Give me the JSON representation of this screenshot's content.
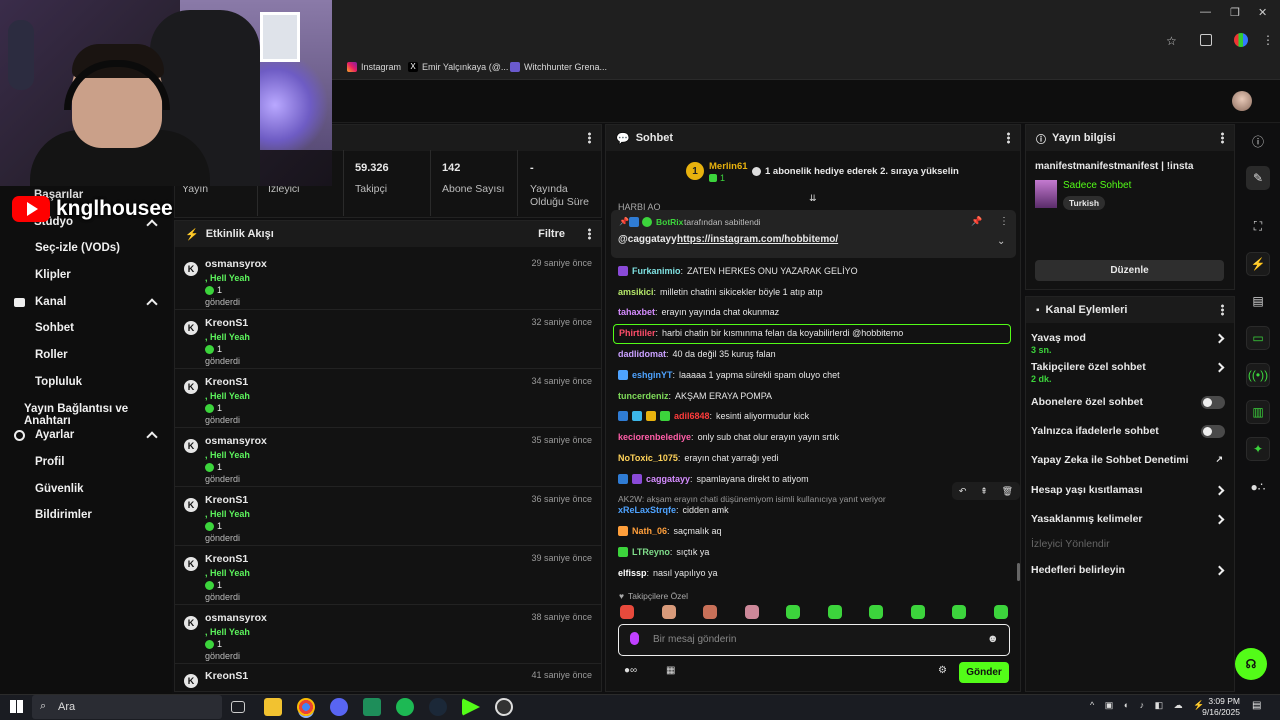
{
  "browser": {
    "bookmarks": [
      {
        "label": "Instagram",
        "icon": "instagram-icon"
      },
      {
        "label": "Emir Yalçınkaya (@...",
        "icon": "x-icon"
      },
      {
        "label": "Witchhunter Grena...",
        "icon": "shield-icon"
      }
    ]
  },
  "overlay": {
    "channel_name": "knglhousee"
  },
  "sidebar": {
    "partial_items": [
      "Başarılar",
      "Stüdyo"
    ],
    "items": [
      {
        "label": "Seç-izle (VODs)"
      },
      {
        "label": "Klipler"
      }
    ],
    "kanal": {
      "label": "Kanal",
      "items": [
        "Sohbet",
        "Roller",
        "Topluluk"
      ]
    },
    "baglanti": "Yayın Bağlantısı ve Anahtarı",
    "ayarlar": {
      "label": "Ayarlar",
      "items": [
        "Profil",
        "Güvenlik",
        "Bildirimler"
      ]
    }
  },
  "stats": {
    "yayin": {
      "label": "Yayın"
    },
    "izleyici": {
      "label": "İzleyici"
    },
    "takipci": {
      "value": "59.326",
      "label": "Takipçi"
    },
    "abone": {
      "value": "142",
      "label": "Abone Sayısı"
    },
    "sure": {
      "value": "-",
      "label": "Yayında Olduğu Süre"
    }
  },
  "activity": {
    "title": "Etkinlik Akışı",
    "filter": "Filtre",
    "items": [
      {
        "name": "osmansyrox",
        "sub": ", Hell Yeah",
        "count": "1",
        "gave": "gönderdi",
        "time": "29 saniye önce"
      },
      {
        "name": "KreonS1",
        "sub": ", Hell Yeah",
        "count": "1",
        "gave": "gönderdi",
        "time": "32 saniye önce"
      },
      {
        "name": "KreonS1",
        "sub": ", Hell Yeah",
        "count": "1",
        "gave": "gönderdi",
        "time": "34 saniye önce"
      },
      {
        "name": "osmansyrox",
        "sub": ", Hell Yeah",
        "count": "1",
        "gave": "gönderdi",
        "time": "35 saniye önce"
      },
      {
        "name": "KreonS1",
        "sub": ", Hell Yeah",
        "count": "1",
        "gave": "gönderdi",
        "time": "36 saniye önce"
      },
      {
        "name": "KreonS1",
        "sub": ", Hell Yeah",
        "count": "1",
        "gave": "gönderdi",
        "time": "39 saniye önce"
      },
      {
        "name": "osmansyrox",
        "sub": ", Hell Yeah",
        "count": "1",
        "gave": "gönderdi",
        "time": "38 saniye önce"
      },
      {
        "name": "KreonS1",
        "sub": "",
        "count": "",
        "gave": "",
        "time": "41 saniye önce"
      }
    ]
  },
  "chat": {
    "title": "Sohbet",
    "leader": {
      "rank": "1",
      "name": "Merlin61",
      "count": "1",
      "text": "1 abonelik hediye ederek 2. sıraya yükselin"
    },
    "partial_top": "HARBI AO",
    "pinned": {
      "by": "BotRix",
      "by_suffix": "tarafından sabitlendi",
      "user": "@caggatayy",
      "link": "https://instagram.com/hobbitemo/"
    },
    "messages": [
      {
        "user": "Furkanimio",
        "color": "#7ee0e0",
        "text": "ZATEN HERKES ONU YAZARAK GELİYO"
      },
      {
        "user": "amsikici",
        "color": "#b6e86a",
        "text": "milletin chatini sikicekler böyle 1 atıp atıp"
      },
      {
        "user": "tahaxbet",
        "color": "#d58cff",
        "text": "erayın yayında chat okunmaz"
      },
      {
        "user": "Phirtiiler",
        "color": "#ff4d6a",
        "text": "harbi chatin bir kısmınma felan da koyabilirlerdi @hobbitemo"
      },
      {
        "user": "dadlidomat",
        "color": "#c9a0ff",
        "text": "40 da değil 35 kuruş falan"
      },
      {
        "user": "eshginYT",
        "color": "#4ea3ff",
        "text": "laaaaa 1 yapma sürekli spam oluyo chet"
      },
      {
        "user": "tuncerdeniz",
        "color": "#7fdc5a",
        "text": "AKŞAM ERAYA POMPA"
      },
      {
        "user": "adil6848",
        "color": "#ff3b3b",
        "text": "kesinti aliyormudur kick"
      },
      {
        "user": "keciorenbelediye",
        "color": "#ff5ea8",
        "text": "only sub chat olur erayın yayın srtık"
      },
      {
        "user": "NoToxic_1075",
        "color": "#ffd35a",
        "text": "erayın chat yarrağı yedi"
      },
      {
        "user": "caggatayy",
        "color": "#d58cff",
        "text": "spamlayana direkt to atiyom"
      },
      {
        "user": "xReLaxStrqfe",
        "color": "#4ea3ff",
        "text": "cidden amk"
      },
      {
        "user": "Nath_06",
        "color": "#ff9f3b",
        "text": "saçmalık aq"
      },
      {
        "user": "LTReyno",
        "color": "#7fdc8a",
        "text": "sıçtık ya"
      },
      {
        "user": "elfissp",
        "color": "#ffffff",
        "text": "nasıl yapılıyo ya"
      }
    ],
    "reply_to": "AK2W: akşam erayın chati düşünemiyom isimli kullanıcıya yanıt veriyor",
    "followers_only_label": "Takipçilere Özel",
    "input_placeholder": "Bir mesaj gönderin",
    "send": "Gönder"
  },
  "stream_info": {
    "title": "Yayın bilgisi",
    "stream_title": "manifestmanifestmanifest | !insta",
    "category": "Sadece Sohbet",
    "tag": "Turkish",
    "edit": "Düzenle"
  },
  "channel_actions": {
    "title": "Kanal Eylemleri",
    "slow_mode": {
      "label": "Yavaş mod",
      "value": "3 sn."
    },
    "followers_chat": {
      "label": "Takipçilere özel sohbet",
      "value": "2 dk."
    },
    "subs_chat": "Abonelere özel sohbet",
    "emote_chat": "Yalnızca ifadelerle sohbet",
    "ai_mod": "Yapay Zeka ile Sohbet Denetimi",
    "account_age": "Hesap yaşı kısıtlaması",
    "banned_words": "Yasaklanmış kelimeler",
    "redirect": "İzleyici Yönlendir",
    "goals": "Hedefleri belirleyin"
  },
  "taskbar": {
    "search": "Ara",
    "time": "3:09 PM",
    "date": "9/16/2025"
  },
  "colors": {
    "accent": "#53fc18",
    "bg": "#0f0f10",
    "panel": "#121212"
  }
}
